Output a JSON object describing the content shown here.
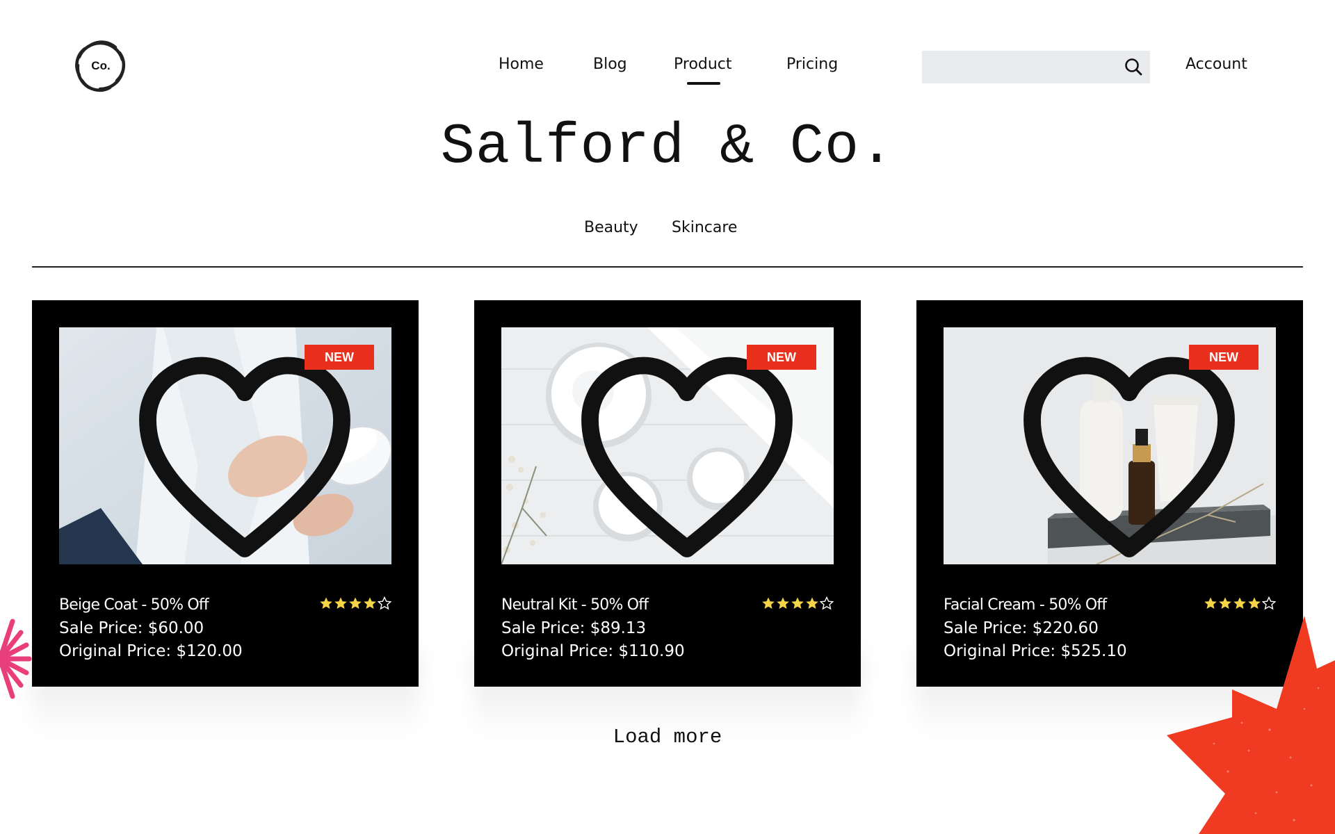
{
  "header": {
    "logo_text": "Co.",
    "nav": [
      {
        "label": "Home"
      },
      {
        "label": "Blog"
      },
      {
        "label": "Product"
      },
      {
        "label": "Pricing"
      }
    ],
    "active_nav": "Product",
    "search": {
      "value": "",
      "icon": "search-icon"
    },
    "account_label": "Account"
  },
  "brand": {
    "title": "Salford & Co."
  },
  "categories": [
    "Beauty",
    "Skincare"
  ],
  "products": [
    {
      "badge": "NEW",
      "name": "Beige Coat - 50% Off",
      "sale": "Sale Price: $60.00",
      "original": "Original Price: $120.00",
      "rating": 4,
      "rating_max": 5,
      "icon": "heart-outline-icon"
    },
    {
      "badge": "NEW",
      "name": "Neutral Kit - 50% Off",
      "sale": "Sale Price: $89.13",
      "original": "Original Price: $110.90",
      "rating": 4,
      "rating_max": 5,
      "icon": "heart-outline-icon"
    },
    {
      "badge": "NEW",
      "name": "Facial Cream - 50% Off",
      "sale": "Sale Price: $220.60",
      "original": "Original Price: $525.10",
      "rating": 4,
      "rating_max": 5,
      "icon": "heart-outline-icon"
    }
  ],
  "load_more_label": "Load more",
  "colors": {
    "badge": "#e8301c",
    "star": "#f5d547",
    "card": "#000000",
    "search_bg": "#e9ebef",
    "accent_red": "#f03a22",
    "accent_pink": "#e83e7a"
  }
}
